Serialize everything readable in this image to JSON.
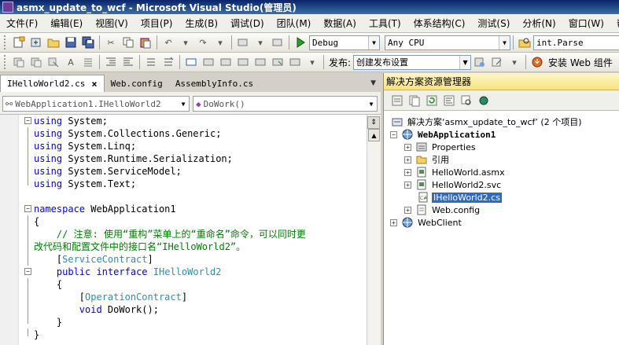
{
  "window": {
    "title": "asmx_update_to_wcf - Microsoft Visual Studio(管理员)"
  },
  "menu": [
    "文件(F)",
    "编辑(E)",
    "视图(V)",
    "项目(P)",
    "生成(B)",
    "调试(D)",
    "团队(M)",
    "数据(A)",
    "工具(T)",
    "体系结构(C)",
    "测试(S)",
    "分析(N)",
    "窗口(W)",
    "帮助(H)"
  ],
  "toolbar": {
    "config": "Debug",
    "platform": "Any CPU",
    "find": "int.Parse",
    "publish_label": "发布:",
    "publish_value": "创建发布设置",
    "install_label": "安装 Web 组件"
  },
  "editor": {
    "tabs": [
      {
        "label": "IHelloWorld2.cs",
        "active": true
      },
      {
        "label": "Web.config",
        "active": false
      },
      {
        "label": "AssemblyInfo.cs",
        "active": false
      }
    ],
    "nav_left": "WebApplication1.IHelloWorld2",
    "nav_right": "DoWork()",
    "code": {
      "l1_kw": "using",
      "l1_rest": " System;",
      "l2_kw": "using",
      "l2_rest": " System.Collections.Generic;",
      "l3_kw": "using",
      "l3_rest": " System.Linq;",
      "l4_kw": "using",
      "l4_rest": " System.Runtime.Serialization;",
      "l5_kw": "using",
      "l5_rest": " System.ServiceModel;",
      "l6_kw": "using",
      "l6_rest": " System.Text;",
      "l8_kw": "namespace",
      "l8_rest": " WebApplication1",
      "l9": "{",
      "l10_cmt": "    // 注意: 使用“重构”菜单上的“重命名”命令，可以同时更",
      "l11_cmt": "改代码和配置文件中的接口名“IHelloWorld2”。",
      "l12_open": "    [",
      "l12_type": "ServiceContract",
      "l12_close": "]",
      "l13_kw1": "public",
      "l13_kw2": "interface",
      "l13_type": "IHelloWorld2",
      "l14": "    {",
      "l15_open": "        [",
      "l15_type": "OperationContract",
      "l15_close": "]",
      "l16_kw": "void",
      "l16_rest": " DoWork();",
      "l17": "    }",
      "l18": "}"
    }
  },
  "solution_explorer": {
    "title": "解决方案资源管理器",
    "solution": "解决方案‘asmx_update_to_wcf’ (2 个项目)",
    "project1": "WebApplication1",
    "items": [
      "Properties",
      "引用",
      "HelloWorld.asmx",
      "HelloWorld2.svc",
      "IHelloWorld2.cs",
      "Web.config"
    ],
    "selected_item": "IHelloWorld2.cs",
    "project2": "WebClient"
  }
}
